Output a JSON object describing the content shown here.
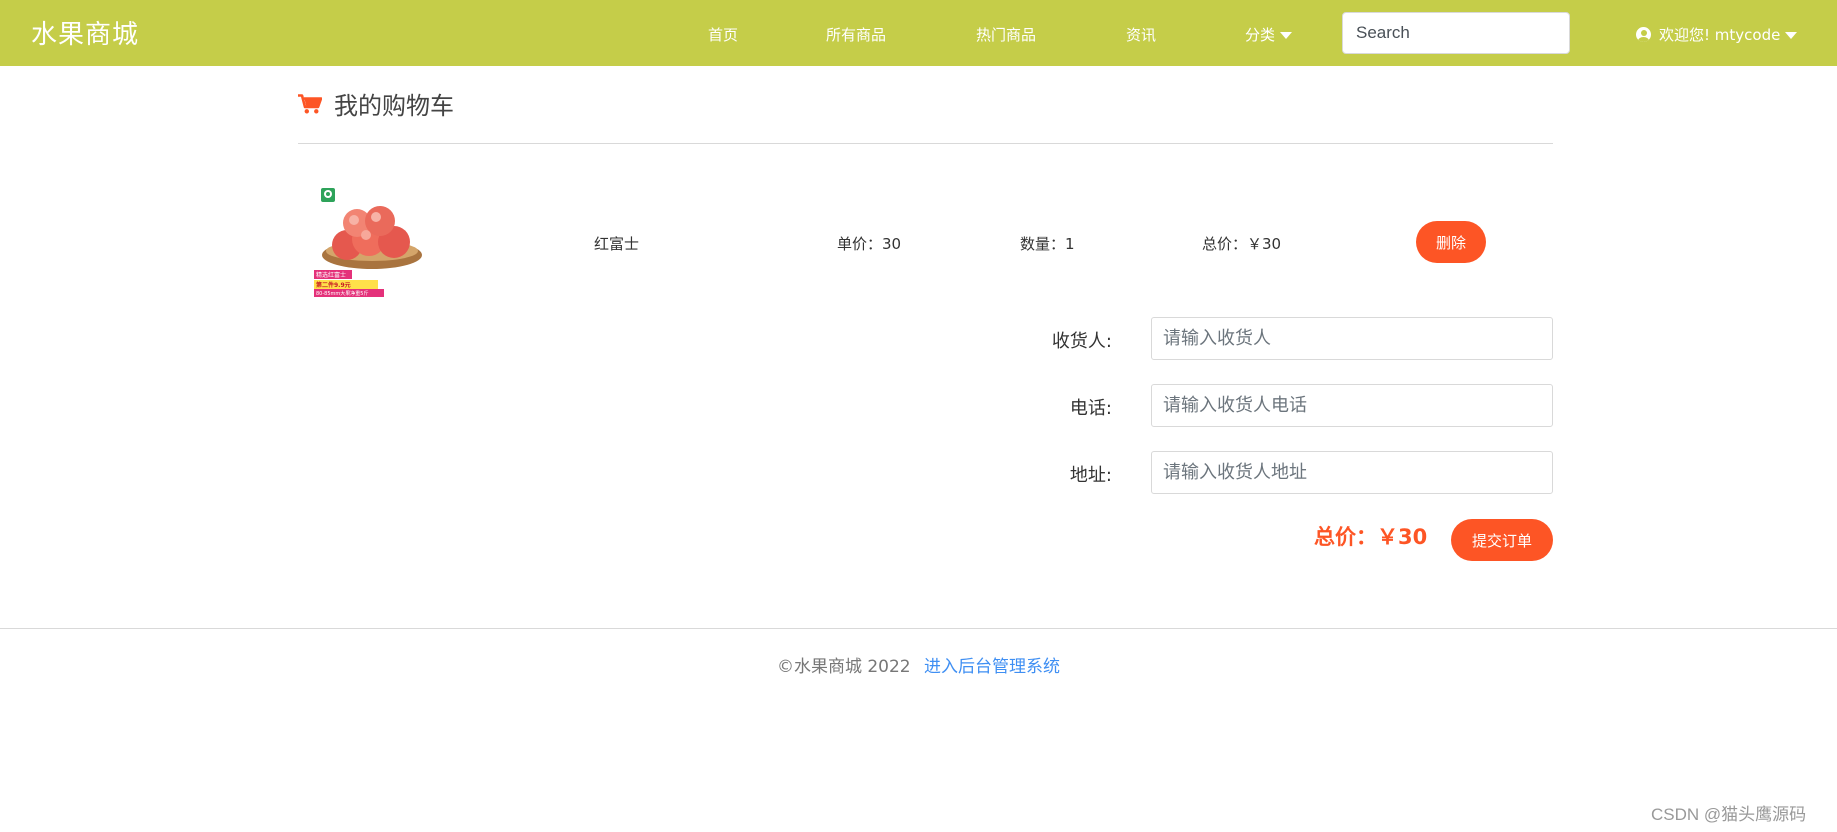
{
  "navbar": {
    "brand": "水果商城",
    "links": [
      "首页",
      "所有商品",
      "热门商品",
      "资讯"
    ],
    "category_label": "分类",
    "search_placeholder": "Search",
    "user_label": "欢迎您! mtycode",
    "color": "#c5cd49"
  },
  "page": {
    "title": "我的购物车"
  },
  "cart": {
    "items": [
      {
        "name": "红富士",
        "unit_price": "单价：30",
        "quantity": "数量：1",
        "total": "总价：￥30",
        "delete_label": "删除",
        "image": {
          "promo_line1": "精选红富士",
          "promo_line2": "第二件9.9元",
          "promo_line3": "80-85mm大果净重5斤"
        }
      }
    ]
  },
  "form": {
    "name_label": "收货人:",
    "name_placeholder": "请输入收货人",
    "phone_label": "电话:",
    "phone_placeholder": "请输入收货人电话",
    "address_label": "地址:",
    "address_placeholder": "请输入收货人地址"
  },
  "order": {
    "grand_total": "总价：￥30",
    "submit_label": "提交订单"
  },
  "footer": {
    "copyright": "©水果商城 2022",
    "admin_link": "进入后台管理系统"
  },
  "watermark": "CSDN @猫头鹰源码",
  "colors": {
    "accent": "#fd5525",
    "link": "#3f8ff3"
  }
}
